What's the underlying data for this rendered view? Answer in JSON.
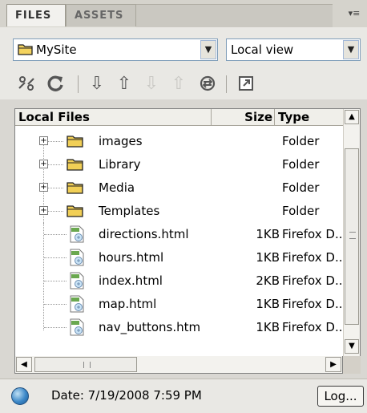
{
  "tabs": [
    {
      "label": "FILES",
      "active": true
    },
    {
      "label": "ASSETS",
      "active": false
    }
  ],
  "panel_menu_icon": "panel-options-icon",
  "site_select": {
    "value": "MySite"
  },
  "view_select": {
    "value": "Local view"
  },
  "toolbar": [
    {
      "icon": "connect-icon",
      "enabled": true
    },
    {
      "icon": "refresh-icon",
      "enabled": true
    },
    {
      "icon": "get-files-icon",
      "enabled": true
    },
    {
      "icon": "put-files-icon",
      "enabled": true
    },
    {
      "icon": "check-out-icon",
      "enabled": false
    },
    {
      "icon": "check-in-icon",
      "enabled": false
    },
    {
      "icon": "synchronize-icon",
      "enabled": true
    },
    {
      "icon": "expand-icon",
      "enabled": true
    }
  ],
  "columns": {
    "name": "Local Files",
    "size": "Size",
    "type": "Type"
  },
  "files": [
    {
      "name": "images",
      "size": "",
      "type": "Folder",
      "kind": "folder"
    },
    {
      "name": "Library",
      "size": "",
      "type": "Folder",
      "kind": "folder"
    },
    {
      "name": "Media",
      "size": "",
      "type": "Folder",
      "kind": "folder"
    },
    {
      "name": "Templates",
      "size": "",
      "type": "Folder",
      "kind": "folder"
    },
    {
      "name": "directions.html",
      "size": "1KB",
      "type": "Firefox D..",
      "kind": "html"
    },
    {
      "name": "hours.html",
      "size": "1KB",
      "type": "Firefox D..",
      "kind": "html"
    },
    {
      "name": "index.html",
      "size": "2KB",
      "type": "Firefox D..",
      "kind": "html"
    },
    {
      "name": "map.html",
      "size": "1KB",
      "type": "Firefox D..",
      "kind": "html"
    },
    {
      "name": "nav_buttons.htm",
      "size": "1KB",
      "type": "Firefox D..",
      "kind": "html"
    }
  ],
  "status": {
    "text": "Date: 7/19/2008 7:59 PM",
    "log_label": "Log..."
  },
  "colors": {
    "folder": "#e6c44a",
    "accent_border": "#7f9db9"
  }
}
